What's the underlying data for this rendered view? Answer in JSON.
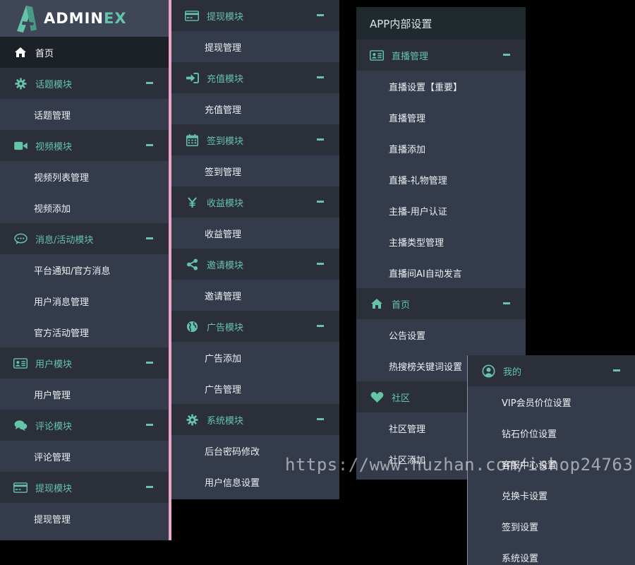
{
  "brand": {
    "text_admin": "ADMIN",
    "text_ex": "EX"
  },
  "panel1": {
    "home": "首页",
    "groups": [
      {
        "title": "话题模块",
        "icon": "gear-icon",
        "items": [
          "话题管理"
        ]
      },
      {
        "title": "视频模块",
        "icon": "video-camera-icon",
        "items": [
          "视频列表管理",
          "视频添加"
        ]
      },
      {
        "title": "消息/活动模块",
        "icon": "chat-bubble-icon",
        "items": [
          "平台通知/官方消息",
          "用户消息管理",
          "官方活动管理"
        ]
      },
      {
        "title": "用户模块",
        "icon": "id-card-icon",
        "items": [
          "用户管理"
        ]
      },
      {
        "title": "评论模块",
        "icon": "comments-icon",
        "items": [
          "评论管理"
        ]
      },
      {
        "title": "提现模块",
        "icon": "credit-card-icon",
        "items": [
          "提现管理"
        ]
      }
    ]
  },
  "panel2": {
    "groups": [
      {
        "title": "提现模块",
        "icon": "credit-card-icon",
        "items": [
          "提现管理"
        ]
      },
      {
        "title": "充值模块",
        "icon": "sign-in-icon",
        "items": [
          "充值管理"
        ]
      },
      {
        "title": "签到模块",
        "icon": "calendar-icon",
        "items": [
          "签到管理"
        ]
      },
      {
        "title": "收益模块",
        "icon": "yen-icon",
        "items": [
          "收益管理"
        ]
      },
      {
        "title": "邀请模块",
        "icon": "share-icon",
        "items": [
          "邀请管理"
        ]
      },
      {
        "title": "广告模块",
        "icon": "globe-icon",
        "items": [
          "广告添加",
          "广告管理"
        ]
      },
      {
        "title": "系统模块",
        "icon": "gear-icon",
        "items": [
          "后台密码修改",
          "用户信息设置"
        ]
      }
    ]
  },
  "panel3": {
    "title": "APP内部设置",
    "groups": [
      {
        "title": "直播管理",
        "icon": "id-card-icon",
        "items": [
          "直播设置【重要】",
          "直播管理",
          "直播添加",
          "直播-礼物管理",
          "主播-用户认证",
          "主播类型管理",
          "直播间AI自动发言"
        ]
      },
      {
        "title": "首页",
        "icon": "home-icon",
        "items": [
          "公告设置",
          "热搜榜关键词设置"
        ]
      },
      {
        "title": "社区",
        "icon": "heart-icon",
        "items": [
          "社区管理",
          "社区添加"
        ]
      }
    ]
  },
  "panel4": {
    "groups": [
      {
        "title": "我的",
        "icon": "user-circle-icon",
        "items": [
          "VIP会员价位设置",
          "钻石价位设置",
          "客服中心设置",
          "兑换卡设置",
          "签到设置",
          "系统设置"
        ]
      }
    ]
  },
  "watermark": "https://www.huzhan.com/ishop24763",
  "colors": {
    "accent": "#65c3a7",
    "panel_bg": "#343b4b",
    "header_bg": "#2a2f3a",
    "home_bg": "#1b2126",
    "divider": "#e9a6c7"
  }
}
